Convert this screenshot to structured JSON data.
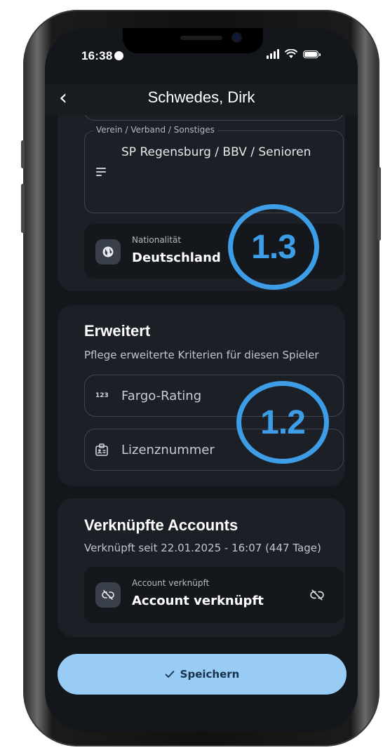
{
  "status": {
    "time": "16:38"
  },
  "nav": {
    "back_icon": "chevron-left-icon",
    "title": "Schwedes, Dirk"
  },
  "club_field": {
    "legend": "Verein / Verband / Sonstiges",
    "value": "SP Regensburg / BBV / Senioren",
    "icon": "text-lines-icon"
  },
  "nationality": {
    "caption": "Nationalität",
    "value": "Deutschland",
    "icon": "globe-icon"
  },
  "extended": {
    "title": "Erweitert",
    "subtitle": "Pflege erweiterte Kriterien für diesen Spieler",
    "fargo": {
      "icon_text": "123",
      "label": "Fargo-Rating"
    },
    "license": {
      "label": "Lizenznummer",
      "icon": "id-badge-icon"
    }
  },
  "linked": {
    "title": "Verknüpfte Accounts",
    "subtitle": "Verknüpft seit 22.01.2025 - 16:07 (447 Tage)",
    "caption": "Account verknüpft",
    "value": "Account verknüpft",
    "icon": "link-off-icon"
  },
  "save_button": {
    "label": "Speichern",
    "icon": "check-icon"
  },
  "annotations": [
    {
      "label": "1.3"
    },
    {
      "label": "1.2"
    }
  ],
  "colors": {
    "accent": "#3d9de6",
    "button": "#99ccf5",
    "background": "#13161b",
    "card": "#1c2026"
  }
}
